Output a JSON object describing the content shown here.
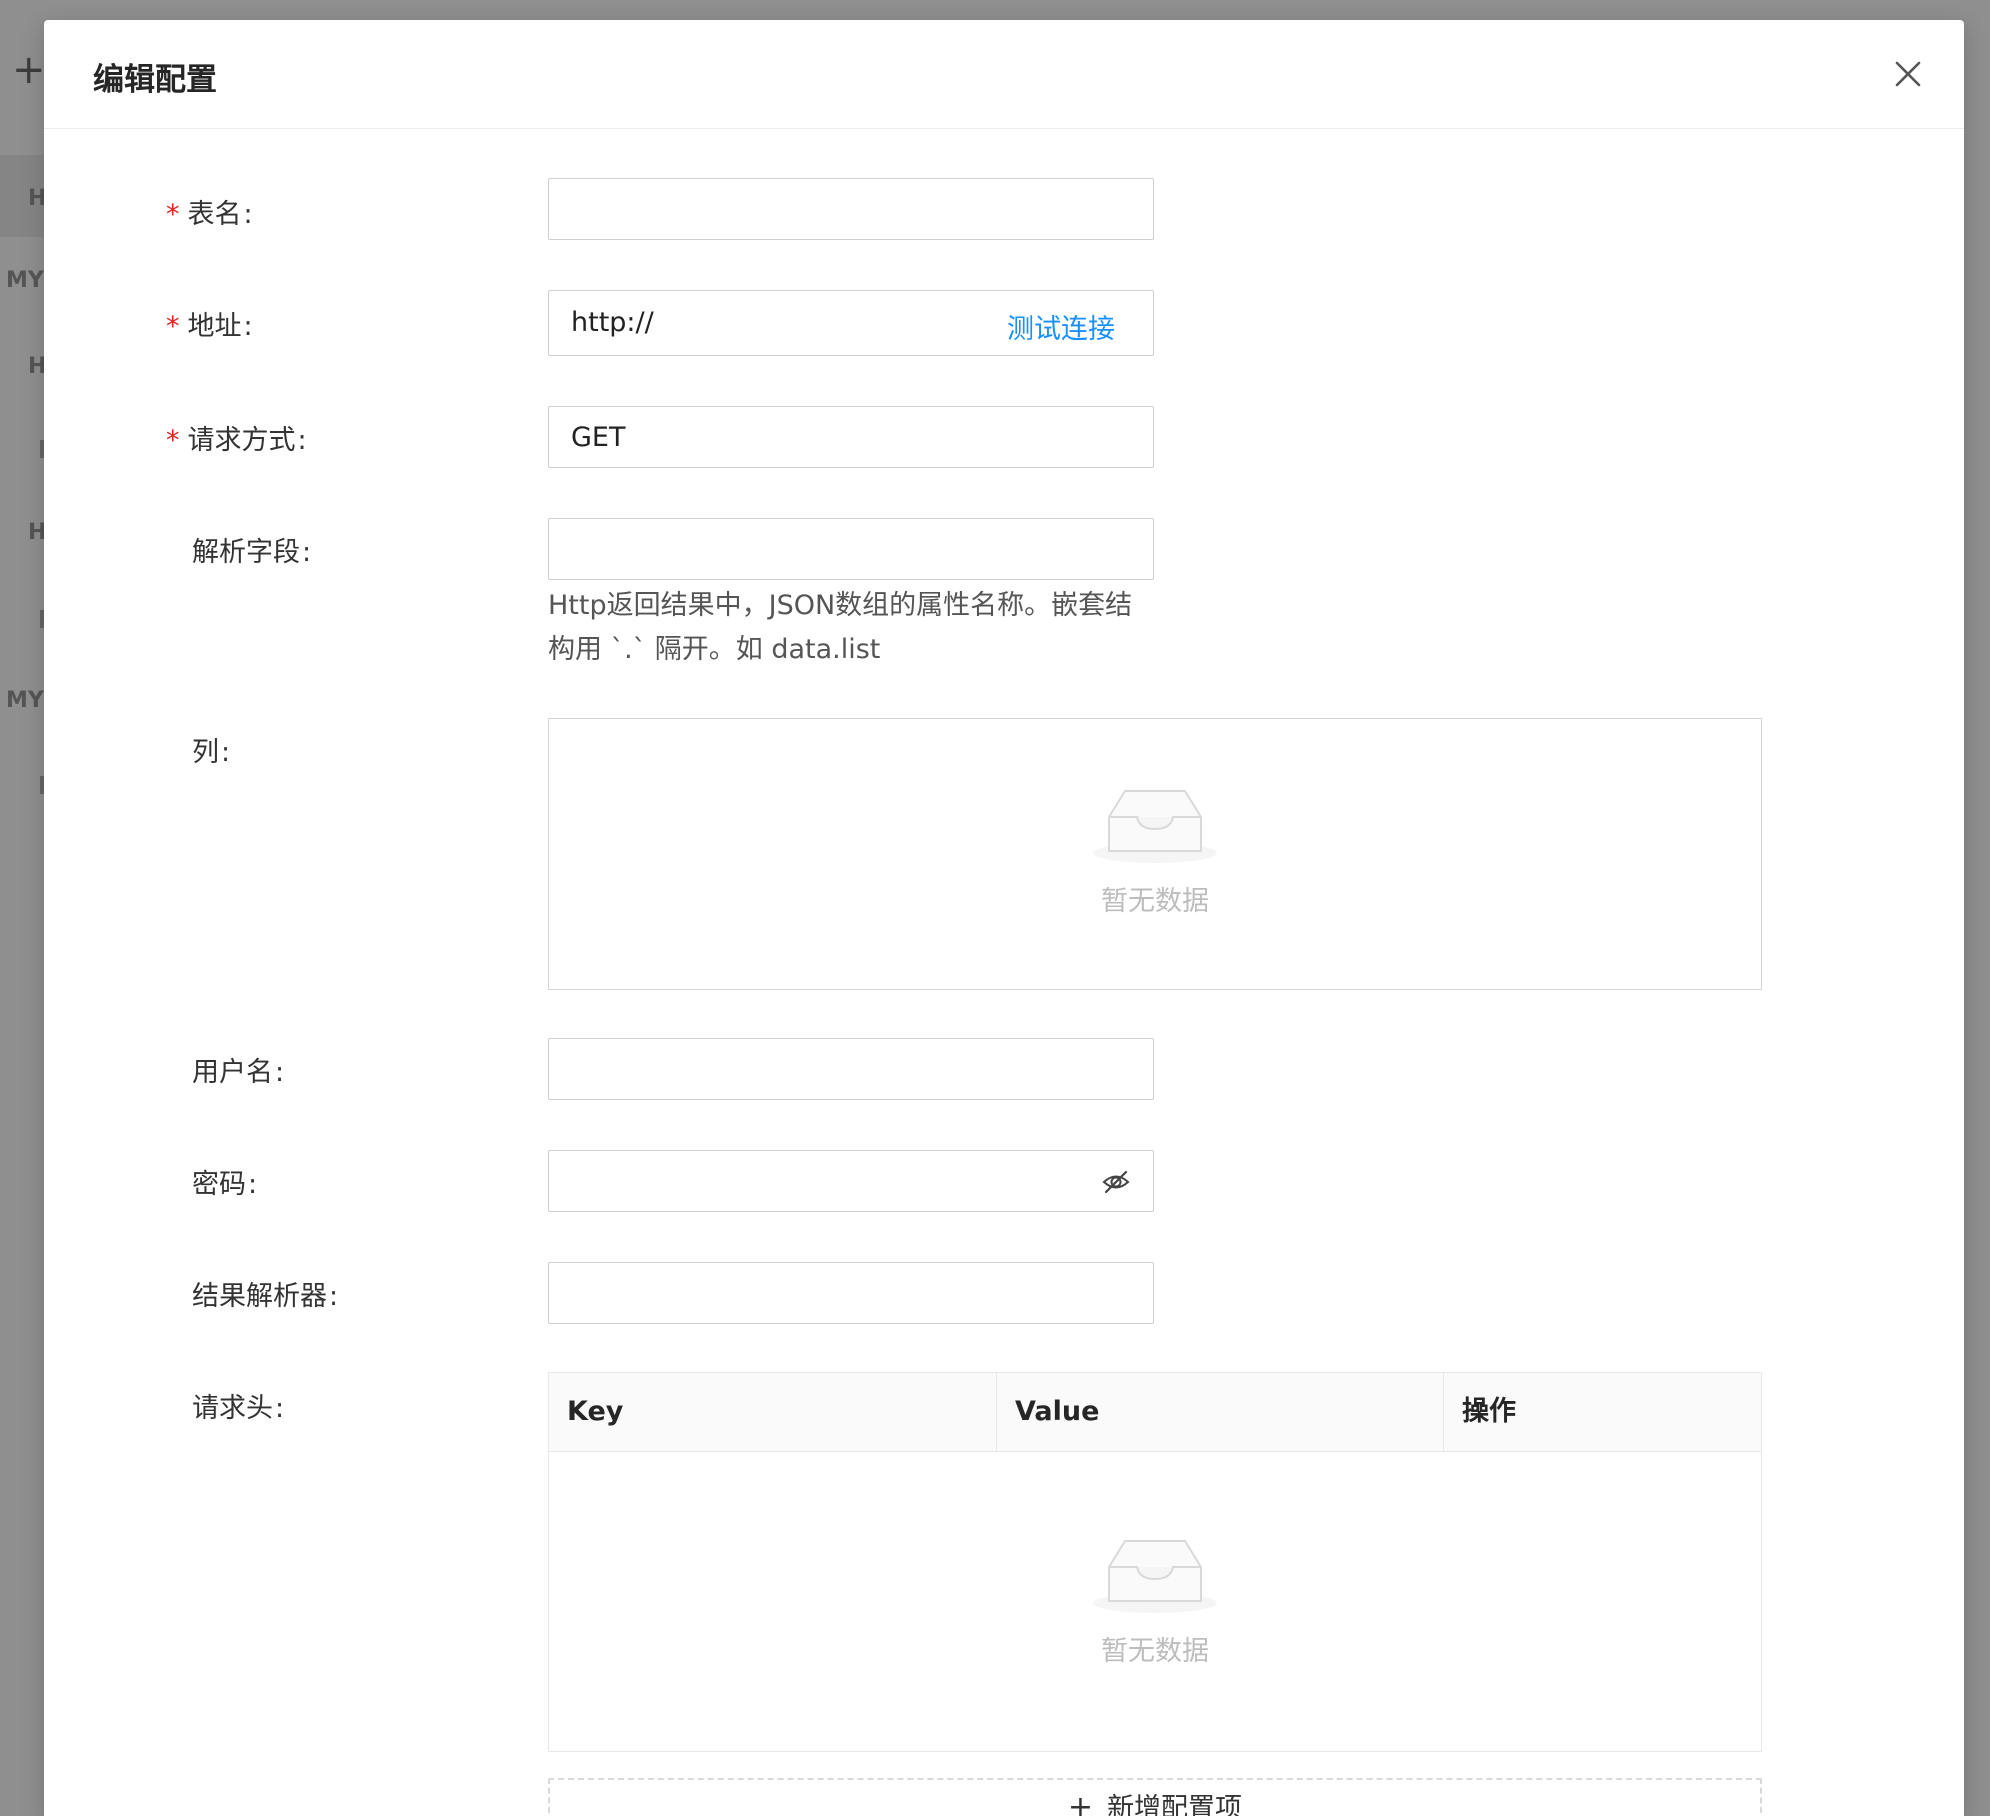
{
  "background": {
    "plus": "+",
    "truncated_labels": [
      "H",
      "MY",
      "H",
      "H",
      "MY"
    ]
  },
  "modal": {
    "title": "编辑配置",
    "close_icon": "close-icon"
  },
  "form": {
    "table_name": {
      "label": "表名",
      "required": true,
      "value": ""
    },
    "address": {
      "label": "地址",
      "required": true,
      "value": "http://",
      "action": "测试连接"
    },
    "method": {
      "label": "请求方式",
      "required": true,
      "value": "GET"
    },
    "parse_field": {
      "label": "解析字段",
      "value": "",
      "help_line1": "Http返回结果中，JSON数组的属性名称。嵌套结",
      "help_line2": "构用 `.` 隔开。如 data.list"
    },
    "columns": {
      "label": "列",
      "empty_text": "暂无数据"
    },
    "username": {
      "label": "用户名",
      "value": ""
    },
    "password": {
      "label": "密码",
      "value": "",
      "icon": "eye-invisible-icon"
    },
    "result_parser": {
      "label": "结果解析器",
      "value": ""
    },
    "headers": {
      "label": "请求头",
      "columns": [
        "Key",
        "Value",
        "操作"
      ],
      "empty_text": "暂无数据",
      "add_label": "新增配置项"
    }
  },
  "colors": {
    "primary": "#1890ff",
    "required": "#e2231a"
  }
}
